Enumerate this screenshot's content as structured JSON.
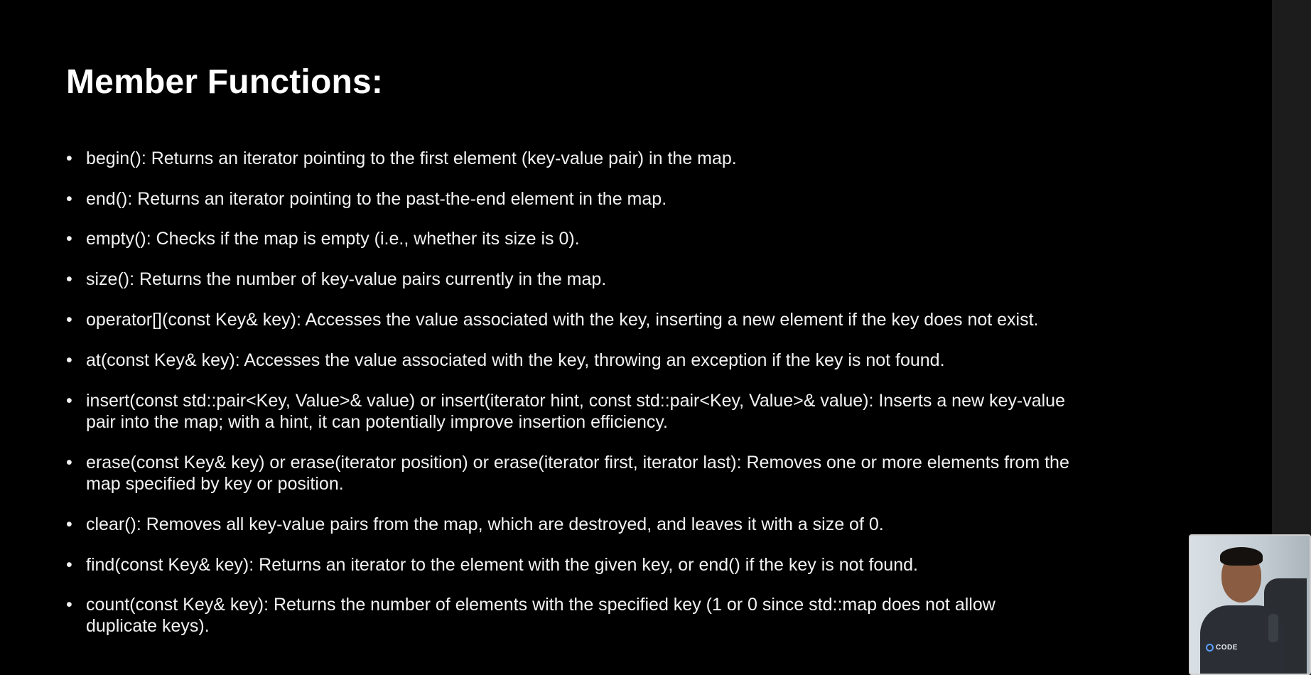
{
  "slide": {
    "title": "Member Functions:",
    "bullet_char": "•",
    "items": [
      {
        "text": "begin(): Returns an iterator pointing to the first element (key-value pair) in the map."
      },
      {
        "text": "end(): Returns an iterator pointing to the past-the-end element in the map."
      },
      {
        "text": "empty(): Checks if the map is empty (i.e., whether its size is 0)."
      },
      {
        "text": "size(): Returns the number of key-value pairs currently in the map."
      },
      {
        "text": "operator[](const Key& key): Accesses the value associated with the key, inserting a new element if the key does not exist."
      },
      {
        "text": "at(const Key& key): Accesses the value associated with the key, throwing an exception if the key is not found."
      },
      {
        "line1": "insert(const std::pair<Key, Value>& value) or insert(iterator hint, const std::pair<Key, Value>& value): Inserts a new key-value",
        "line2": "pair into the map; with a hint, it can potentially improve insertion efficiency."
      },
      {
        "line1": "erase(const Key& key) or erase(iterator position) or erase(iterator first, iterator last): Removes one or more elements from the",
        "line2": "map specified by key or position."
      },
      {
        "text": "clear(): Removes all key-value pairs from the map, which are destroyed, and leaves it with a size of 0."
      },
      {
        "text": "find(const Key& key): Returns an iterator to the element with the given key, or end() if the key is not found."
      },
      {
        "line1": "count(const Key& key): Returns the number of elements with the specified key (1 or 0 since std::map does not allow",
        "line2": "duplicate keys)."
      }
    ]
  },
  "webcam": {
    "brand_label": "CODE"
  },
  "colors": {
    "background": "#000000",
    "text": "#f2f2f2",
    "title": "#ffffff",
    "gutter": "#1c1c1c"
  }
}
